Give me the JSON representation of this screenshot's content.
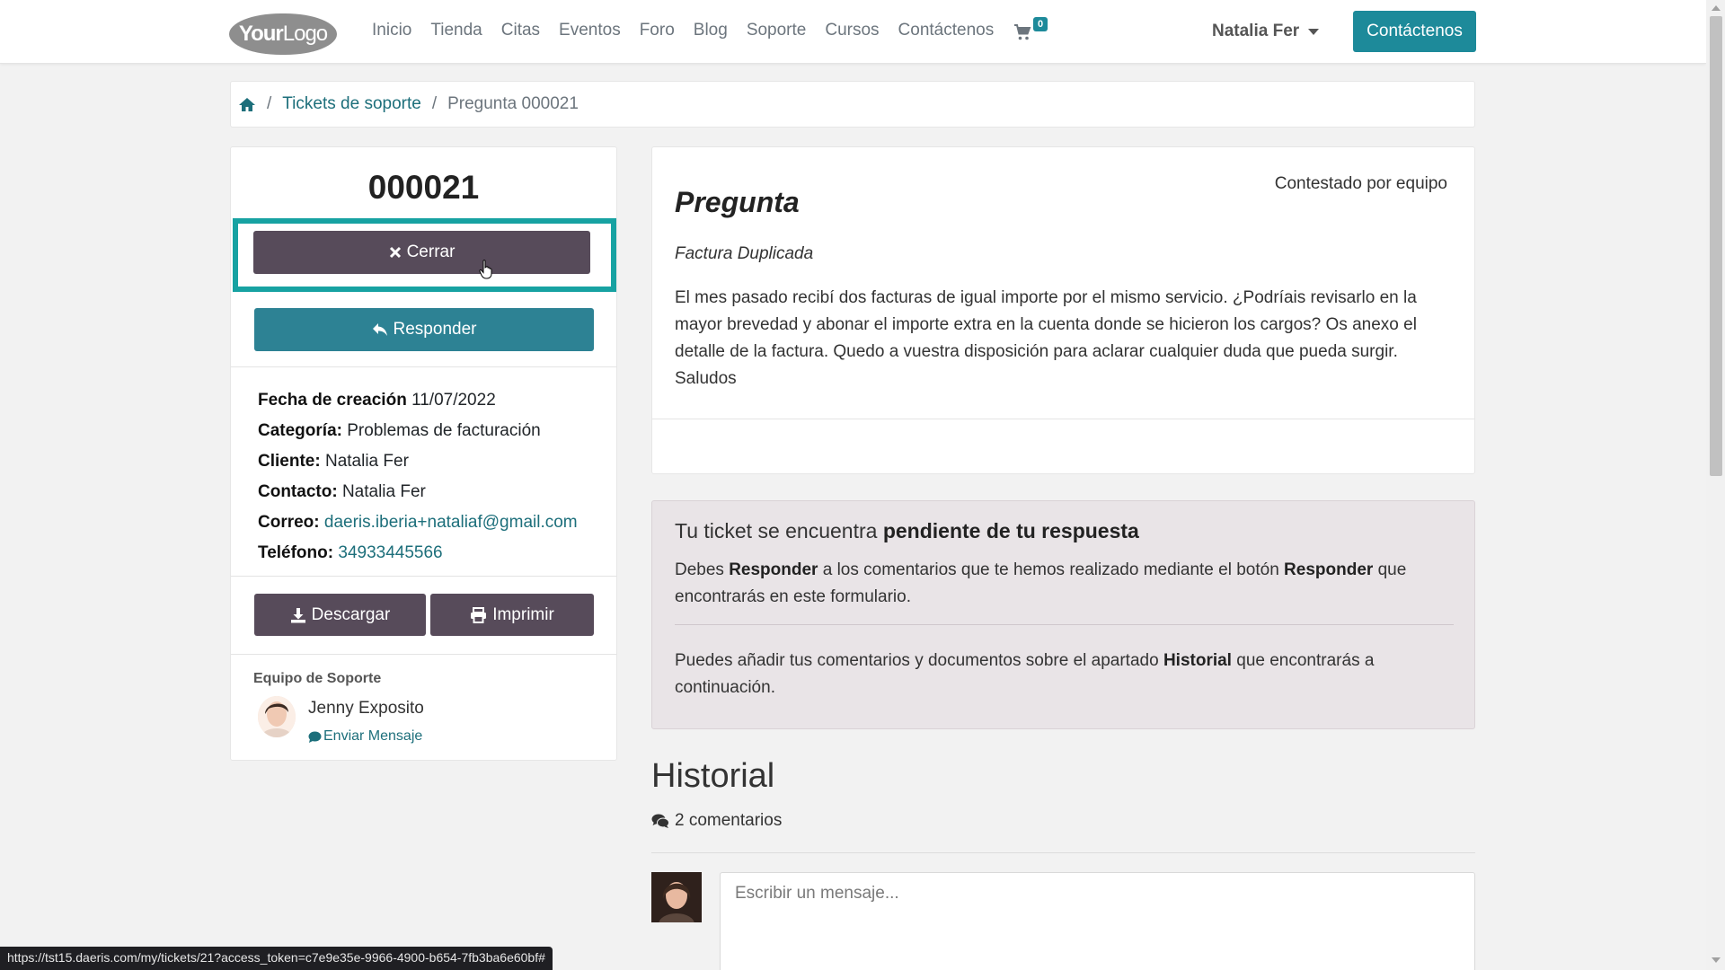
{
  "navbar": {
    "logo_text_bold": "Your",
    "logo_text_light": "Logo",
    "links": [
      "Inicio",
      "Tienda",
      "Citas",
      "Eventos",
      "Foro",
      "Blog",
      "Soporte",
      "Cursos",
      "Contáctenos"
    ],
    "cart_count": "0",
    "user_name": "Natalia Fer",
    "contact_button": "Contáctenos"
  },
  "breadcrumb": {
    "items": [
      "Tickets de soporte"
    ],
    "current": "Pregunta 000021"
  },
  "ticket": {
    "number": "000021",
    "close_label": "Cerrar",
    "reply_label": "Responder",
    "fields": [
      {
        "label": "Fecha de creación",
        "value": "11/07/2022"
      },
      {
        "label": "Categoría:",
        "value": "Problemas de facturación"
      },
      {
        "label": "Cliente:",
        "value": "Natalia Fer"
      },
      {
        "label": "Contacto:",
        "value": "Natalia Fer"
      },
      {
        "label": "Correo:",
        "value": "daeris.iberia+nataliaf@gmail.com"
      },
      {
        "label": "Teléfono:",
        "value": "34933445566"
      }
    ],
    "download_label": "Descargar",
    "print_label": "Imprimir",
    "team_title": "Equipo de Soporte",
    "agent_name": "Jenny Exposito",
    "send_message": "Enviar Mensaje"
  },
  "question": {
    "title": "Pregunta",
    "status": "Contestado por equipo",
    "subject": "Factura Duplicada",
    "body": "El mes pasado recibí dos facturas de igual importe por el mismo servicio. ¿Podríais revisarlo en la mayor brevedad y abonar el importe extra en la cuenta donde se hicieron los cargos? Os anexo el detalle de la factura. Quedo a vuestra disposición para aclarar cualquier duda que pueda surgir.",
    "signoff": "Saludos"
  },
  "status_panel": {
    "title_prefix": "Tu ticket se encuentra",
    "title_bold": "pendiente de tu respuesta",
    "p1_a": "Debes",
    "p1_b": "Responder",
    "p1_c": "a los comentarios que te hemos realizado mediante el botón",
    "p1_d": "Responder",
    "p1_e": "que encontrarás en este formulario.",
    "p2_a": "Puedes añadir tus comentarios y documentos sobre el apartado",
    "p2_b": "Historial",
    "p2_c": "que encontrarás a continuación."
  },
  "history": {
    "title": "Historial",
    "comment_count": "2 comentarios",
    "message_placeholder": "Escribir un mensaje..."
  },
  "status_bar_url": "https://tst15.daeris.com/my/tickets/21?access_token=c7e9e35e-9966-4900-b654-7fb3ba6e60bf#",
  "colors": {
    "accent": "#1d8a9a",
    "dark_button": "#574b5a",
    "highlight": "#17a2a2"
  }
}
